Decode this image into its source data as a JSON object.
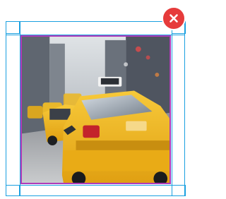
{
  "image": {
    "alt": "",
    "subject": "yellow-taxi-street"
  },
  "controls": {
    "close_icon": "close-icon"
  },
  "colors": {
    "guide_blue": "#1aa0e0",
    "image_border": "#b03ab8",
    "close_red": "#e63b3b",
    "taxi_yellow": "#f2b41c"
  }
}
